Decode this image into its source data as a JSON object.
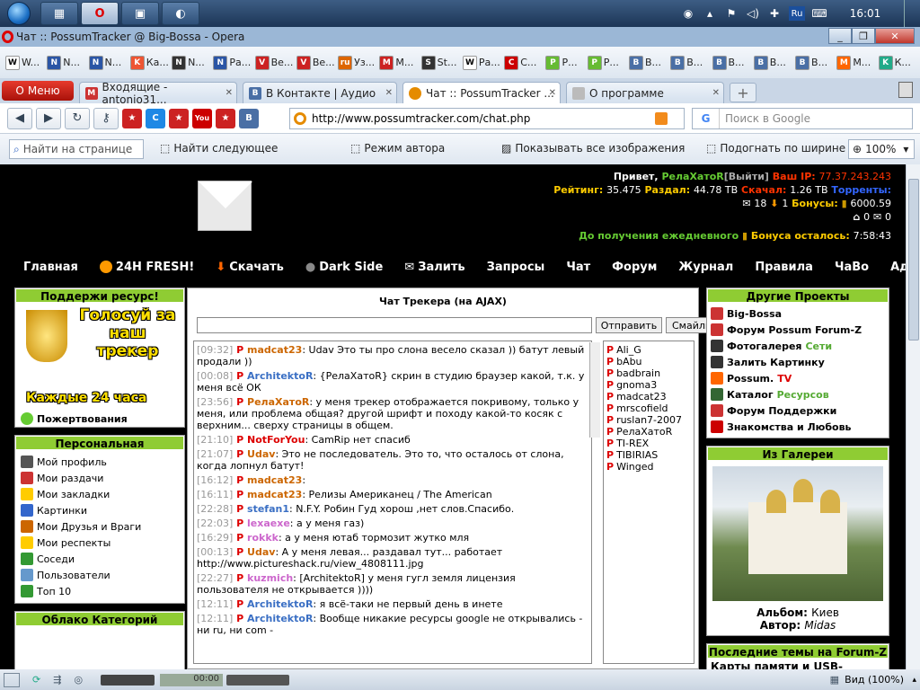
{
  "taskbar": {
    "clock": "16:01",
    "lang": "Ru"
  },
  "window": {
    "title": "Чат :: PossumTracker @ Big-Bossa - Opera"
  },
  "bookmarks": [
    {
      "label": "W...",
      "color": "#fff",
      "text": "W",
      "fg": "#000"
    },
    {
      "label": "N...",
      "color": "#2a55a5",
      "text": "N",
      "fg": "#fff"
    },
    {
      "label": "N...",
      "color": "#2a55a5",
      "text": "N",
      "fg": "#fff"
    },
    {
      "label": "Ка...",
      "color": "#e53",
      "text": "K",
      "fg": "#fff"
    },
    {
      "label": "N...",
      "color": "#333",
      "text": "N",
      "fg": "#fff"
    },
    {
      "label": "Ра...",
      "color": "#2a55a5",
      "text": "N",
      "fg": "#fff"
    },
    {
      "label": "Ве...",
      "color": "#c22",
      "text": "V",
      "fg": "#fff"
    },
    {
      "label": "Ве...",
      "color": "#c22",
      "text": "V",
      "fg": "#fff"
    },
    {
      "label": "Уз...",
      "color": "#d60",
      "text": "ru",
      "fg": "#fff"
    },
    {
      "label": "М...",
      "color": "#c22",
      "text": "M",
      "fg": "#fff"
    },
    {
      "label": "St...",
      "color": "#333",
      "text": "S",
      "fg": "#fff"
    },
    {
      "label": "Ра...",
      "color": "#fff",
      "text": "W",
      "fg": "#000"
    },
    {
      "label": "С...",
      "color": "#c00",
      "text": "C",
      "fg": "#fff"
    },
    {
      "label": "Р...",
      "color": "#6b3",
      "text": "P",
      "fg": "#fff"
    },
    {
      "label": "Р...",
      "color": "#6b3",
      "text": "P",
      "fg": "#fff"
    },
    {
      "label": "В...",
      "color": "#4a6fa5",
      "text": "B",
      "fg": "#fff"
    },
    {
      "label": "В...",
      "color": "#4a6fa5",
      "text": "B",
      "fg": "#fff"
    },
    {
      "label": "В...",
      "color": "#4a6fa5",
      "text": "B",
      "fg": "#fff"
    },
    {
      "label": "В...",
      "color": "#4a6fa5",
      "text": "B",
      "fg": "#fff"
    },
    {
      "label": "В...",
      "color": "#4a6fa5",
      "text": "B",
      "fg": "#fff"
    },
    {
      "label": "М...",
      "color": "#f60",
      "text": "M",
      "fg": "#fff"
    },
    {
      "label": "К...",
      "color": "#2a8",
      "text": "K",
      "fg": "#fff"
    }
  ],
  "tabs": {
    "menu": "Меню",
    "items": [
      {
        "label": "Входящие - antonio31...",
        "fav": "M",
        "favcolor": "#c33"
      },
      {
        "label": "В Контакте | Аудио",
        "fav": "B",
        "favcolor": "#4a6fa5"
      },
      {
        "label": "Чат :: PossumTracker ...",
        "fav": "O",
        "favcolor": "#e58b00"
      },
      {
        "label": "О программе",
        "fav": "",
        "favcolor": "#bbb"
      }
    ]
  },
  "nav": {
    "url": "http://www.possumtracker.com/chat.php",
    "search_placeholder": "Поиск в Google"
  },
  "findbar": {
    "placeholder": "Найти на странице",
    "find_next": "Найти следующее",
    "author_mode": "Режим автора",
    "show_images": "Показывать все изображения",
    "fit_width": "Подогнать по ширине",
    "zoom": "100%"
  },
  "header": {
    "greeting": "Привет,",
    "user": "РелаХатоR",
    "logout": "[Выйти]",
    "ip_label": "Ваш IP:",
    "ip": "77.37.243.243",
    "rating_label": "Рейтинг:",
    "rating": "35.475",
    "shared_label": "Раздал:",
    "shared": "44.78 TB",
    "downloaded_label": "Скачал:",
    "downloaded": "1.26 TB",
    "torrents_label": "Торренты:",
    "seed_count": "18",
    "leech_count": "1",
    "bonus_label": "Бонусы:",
    "bonus": "6000.59",
    "inbox": "0",
    "outbox": "0",
    "daily_pre": "До получения ежедневного",
    "daily_mid": "Бонуса осталось:",
    "daily_time": "7:58:43"
  },
  "mainnav": [
    "Главная",
    "24H FRESH!",
    "Скачать",
    "Dark Side",
    "Залить",
    "Запросы",
    "Чат",
    "Форум",
    "Журнал",
    "Правила",
    "ЧаВо",
    "Администрация"
  ],
  "left": {
    "support_title": "Поддержи ресурс!",
    "promo_top": "Голосуй за наш трекер",
    "promo_bottom": "Каждые 24 часа",
    "donate": "Пожертвования",
    "personal_title": "Персональная",
    "personal": [
      "Мой профиль",
      "Мои раздачи",
      "Мои закладки",
      "Картинки",
      "Мои Друзья и Враги",
      "Мои респекты",
      "Соседи",
      "Пользователи",
      "Топ 10"
    ],
    "cloud_title": "Облако Категорий"
  },
  "chat": {
    "title": "Чат Трекера (на AJAX)",
    "send": "Отправить",
    "smileys": "Смайлы",
    "messages": [
      {
        "time": "[09:32]",
        "nick": "madcat23",
        "color": "#c60",
        "text": ": Udav  Это ты про слона весело сказал )) батут левый продали ))"
      },
      {
        "time": "[00:08]",
        "nick": "ArchitektoR",
        "color": "#3a6fc4",
        "text": ": {РелаХатоR} скрин в студию   браузер какой, т.к. у меня всё ОК"
      },
      {
        "time": "[23:56]",
        "nick": "РелаХатоR",
        "color": "#c60",
        "text": ": у меня трекер отображается покривому, только у меня, или проблема общая? другой шрифт и походу какой-то косяк с верхним... сверху страницы в общем."
      },
      {
        "time": "[21:10]",
        "nick": "NotForYou",
        "color": "#d00",
        "text": ": CamRip нет спасиб"
      },
      {
        "time": "[21:07]",
        "nick": "Udav",
        "color": "#c60",
        "text": ": Это не последователь. Это то, что осталось от слона, когда лопнул батут!"
      },
      {
        "time": "[16:12]",
        "nick": "madcat23",
        "color": "#c60",
        "text": ":"
      },
      {
        "time": "[16:11]",
        "nick": "madcat23",
        "color": "#c60",
        "text": ": Релизы Американец / The American"
      },
      {
        "time": "[22:28]",
        "nick": "stefan1",
        "color": "#3a6fc4",
        "text": ": N.F.Y. Робин Гуд хорош ,нет слов.Спасибо."
      },
      {
        "time": "[22:03]",
        "nick": "lexaexe",
        "color": "#c6c",
        "text": ": а у меня газ)"
      },
      {
        "time": "[16:29]",
        "nick": "rokkk",
        "color": "#c6c",
        "text": ": а у меня ютаб тормозит жутко мля"
      },
      {
        "time": "[00:13]",
        "nick": "Udav",
        "color": "#c60",
        "text": ": А у меня левая... раздавал тут... работает  http://www.pictureshack.ru/view_4808111.jpg"
      },
      {
        "time": "[22:27]",
        "nick": "kuzmich",
        "color": "#c6c",
        "text": ": [ArchitektoR] у меня гугл земля лицензия пользователя не открывается ))))"
      },
      {
        "time": "[12:11]",
        "nick": "ArchitektoR",
        "color": "#3a6fc4",
        "text": ": я всё-таки не первый день в инете"
      },
      {
        "time": "[12:11]",
        "nick": "ArchitektoR",
        "color": "#3a6fc4",
        "text": ": Вообще никакие ресурсы google не открывались - ни ru, ни com  -"
      }
    ],
    "users": [
      "Ali_G",
      "bAbu",
      "badbrain",
      "gnoma3",
      "madcat23",
      "mrscofield",
      "ruslan7-2007",
      "РелаХатоR",
      "TI-REX",
      "TIBIRIAS",
      "Winged"
    ]
  },
  "right": {
    "projects_title": "Другие Проекты",
    "projects": [
      {
        "a": "Big-Bossa",
        "b": ""
      },
      {
        "a": "Форум Possum Forum-Z",
        "b": ""
      },
      {
        "a": "Фотогалерея",
        "b": "Сети"
      },
      {
        "a": "Залить Картинку",
        "b": ""
      },
      {
        "a": "Possum.",
        "b": "TV"
      },
      {
        "a": "Каталог",
        "b": "Ресурсов"
      },
      {
        "a": "Форум Поддержки",
        "b": ""
      },
      {
        "a": "Знакомства и Любовь",
        "b": ""
      }
    ],
    "gallery_title": "Из Галереи",
    "album_label": "Альбом:",
    "album": "Киев",
    "author_label": "Автор:",
    "author": "Midas",
    "forum_title": "Последние темы на Forum-Z",
    "forum_item": "Карты памяти и USB-"
  },
  "status": {
    "time": "00:00",
    "view": "Вид (100%)"
  }
}
